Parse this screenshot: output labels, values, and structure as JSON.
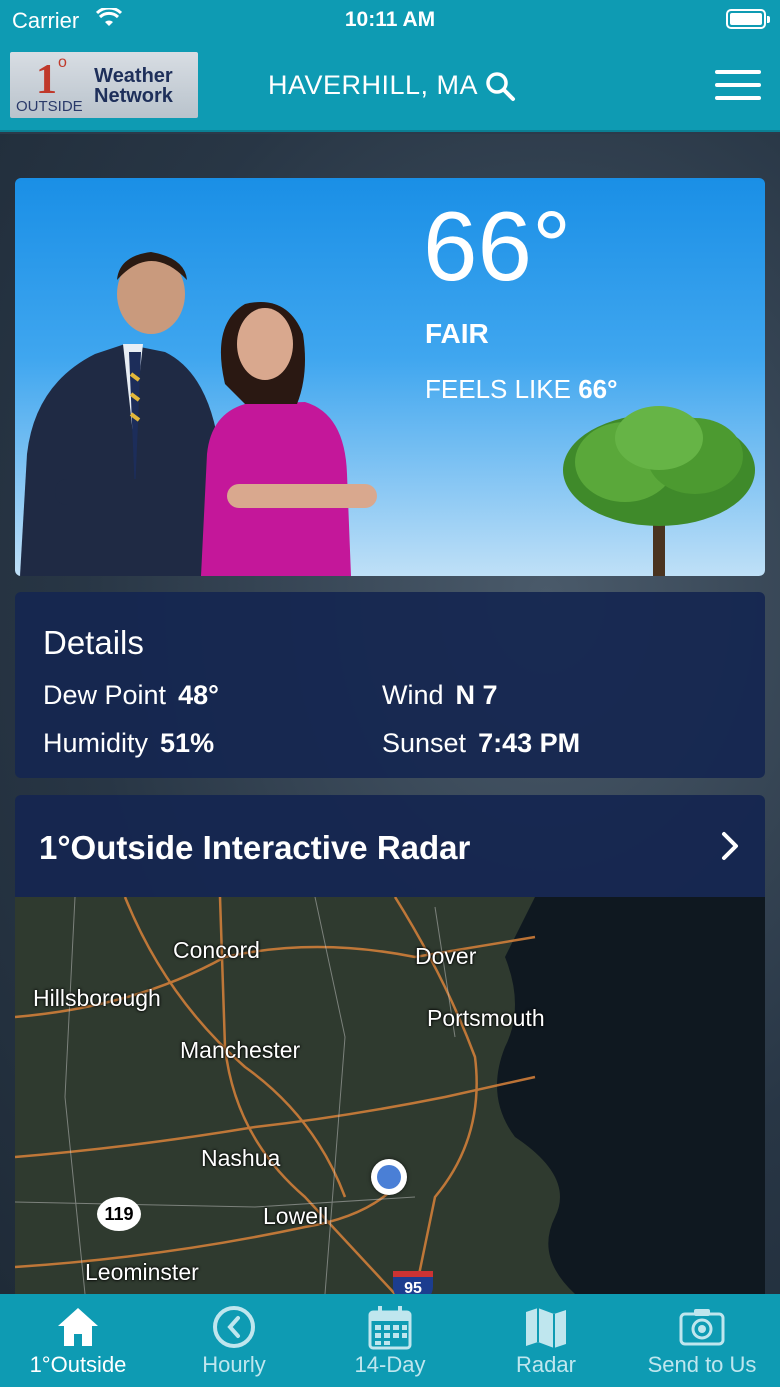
{
  "status_bar": {
    "carrier": "Carrier",
    "time": "10:11 AM"
  },
  "header": {
    "logo": {
      "number": "1",
      "degree": "o",
      "outside": "OUTSIDE",
      "line1": "Weather",
      "line2": "Network"
    },
    "location": "HAVERHILL, MA"
  },
  "current": {
    "temperature": "66°",
    "condition": "FAIR",
    "feels_like_label": "FEELS LIKE",
    "feels_like_value": "66°"
  },
  "details": {
    "title": "Details",
    "dew_point_label": "Dew Point",
    "dew_point_value": "48°",
    "wind_label": "Wind",
    "wind_value": "N 7",
    "humidity_label": "Humidity",
    "humidity_value": "51%",
    "sunset_label": "Sunset",
    "sunset_value": "7:43 PM"
  },
  "radar": {
    "title": "1°Outside Interactive Radar",
    "map_labels": {
      "concord": "Concord",
      "dover": "Dover",
      "hillsborough": "Hillsborough",
      "portsmouth": "Portsmouth",
      "manchester": "Manchester",
      "nashua": "Nashua",
      "lowell": "Lowell",
      "leominster": "Leominster"
    },
    "route_119": "119",
    "route_95": "95"
  },
  "tabs": [
    {
      "label": "1°Outside",
      "icon": "home-icon",
      "active": true
    },
    {
      "label": "Hourly",
      "icon": "clock-icon",
      "active": false
    },
    {
      "label": "14-Day",
      "icon": "calendar-icon",
      "active": false
    },
    {
      "label": "Radar",
      "icon": "map-icon",
      "active": false
    },
    {
      "label": "Send to Us",
      "icon": "camera-icon",
      "active": false
    }
  ],
  "colors": {
    "brand": "#0e9bb3",
    "card": "#152650",
    "location_dot": "#4a7fd6"
  }
}
